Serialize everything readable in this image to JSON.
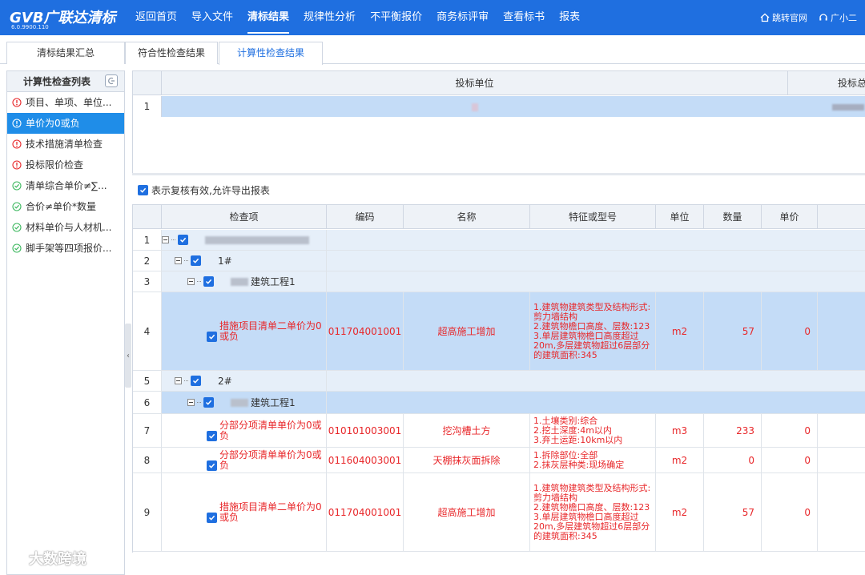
{
  "app": {
    "logo_main": "GVB广联达清标",
    "version": "6.0.9900.110"
  },
  "nav": [
    {
      "label": "返回首页"
    },
    {
      "label": "导入文件"
    },
    {
      "label": "清标结果"
    },
    {
      "label": "规律性分析"
    },
    {
      "label": "不平衡报价"
    },
    {
      "label": "商务标评审"
    },
    {
      "label": "查看标书"
    },
    {
      "label": "报表"
    }
  ],
  "top_right": {
    "website": "跳转官网",
    "assistant": "广小二"
  },
  "tabs": [
    {
      "label": "清标结果汇总"
    },
    {
      "label": "符合性检查结果"
    },
    {
      "label": "计算性检查结果"
    }
  ],
  "sidebar": {
    "title": "计算性检查列表",
    "items": [
      {
        "label": "项目、单项、单位...",
        "status": "warning"
      },
      {
        "label": "单价为0或负",
        "status": "warning"
      },
      {
        "label": "技术措施清单检查",
        "status": "warning"
      },
      {
        "label": "投标限价检查",
        "status": "warning"
      },
      {
        "label": "清单综合单价≠∑...",
        "status": "ok"
      },
      {
        "label": "合价≠单价*数量",
        "status": "ok"
      },
      {
        "label": "材料单价与人材机...",
        "status": "ok"
      },
      {
        "label": "脚手架等四项报价...",
        "status": "ok"
      }
    ]
  },
  "upper_grid": {
    "headers": [
      "投标单位",
      "投标总"
    ],
    "rows": [
      {
        "num": "1"
      }
    ]
  },
  "confirm_check": "表示复核有效,允许导出报表",
  "grid": {
    "headers": [
      "检查项",
      "编码",
      "名称",
      "特征或型号",
      "单位",
      "数量",
      "单价"
    ],
    "rows": [
      {
        "num": "1",
        "item": "",
        "code": "",
        "name": "",
        "feature": "",
        "unit": "",
        "qty": "",
        "price": ""
      },
      {
        "num": "2",
        "item": "1#",
        "code": "",
        "name": "",
        "feature": "",
        "unit": "",
        "qty": "",
        "price": ""
      },
      {
        "num": "3",
        "item": "建筑工程1",
        "code": "",
        "name": "",
        "feature": "",
        "unit": "",
        "qty": "",
        "price": ""
      },
      {
        "num": "4",
        "item": "措施项目清单二单价为0或负",
        "code": "011704001001",
        "name": "超高施工增加",
        "feature": "1.建筑物建筑类型及结构形式:剪力墙结构\n2.建筑物檐口高度、层数:123\n3.单层建筑物檐口高度超过20m,多层建筑物超过6层部分的建筑面积:345",
        "unit": "m2",
        "qty": "57",
        "price": "0"
      },
      {
        "num": "5",
        "item": "2#",
        "code": "",
        "name": "",
        "feature": "",
        "unit": "",
        "qty": "",
        "price": ""
      },
      {
        "num": "6",
        "item": "建筑工程1",
        "code": "",
        "name": "",
        "feature": "",
        "unit": "",
        "qty": "",
        "price": ""
      },
      {
        "num": "7",
        "item": "分部分项清单单价为0或负",
        "code": "010101003001",
        "name": "挖沟槽土方",
        "feature": "1.土壤类别:综合\n2.挖土深度:4m以内\n3.弃土运距:10km以内",
        "unit": "m3",
        "qty": "233",
        "price": "0"
      },
      {
        "num": "8",
        "item": "分部分项清单单价为0或负",
        "code": "011604003001",
        "name": "天棚抹灰面拆除",
        "feature": "1.拆除部位:全部\n2.抹灰层种类:现场确定",
        "unit": "m2",
        "qty": "0",
        "price": "0"
      },
      {
        "num": "9",
        "item": "措施项目清单二单价为0或负",
        "code": "011704001001",
        "name": "超高施工增加",
        "feature": "1.建筑物建筑类型及结构形式:剪力墙结构\n2.建筑物檐口高度、层数:123\n3.单层建筑物檐口高度超过20m,多层建筑物超过6层部分的建筑面积:345",
        "unit": "m2",
        "qty": "57",
        "price": "0"
      }
    ]
  },
  "watermark": "大数跨境",
  "colors": {
    "accent": "#1f6fe0",
    "selected_row": "#c4dcf7",
    "error_text": "#e8272a",
    "ok_icon": "#3db85f",
    "warning_icon": "#e8272a"
  }
}
